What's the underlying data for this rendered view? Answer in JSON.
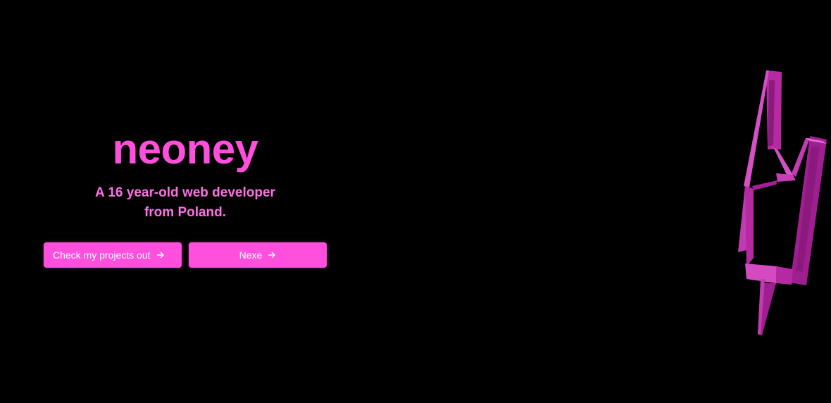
{
  "hero": {
    "title": "neoney",
    "subtitle": "A 16 year-old web developer from Poland."
  },
  "buttons": {
    "projects_label": "Check my projects out",
    "next_label": "Nexe"
  },
  "icons": {
    "button_arrow": "arrow-right-icon",
    "decoration": "lightning-bolt-3d-icon"
  },
  "colors": {
    "background": "#000000",
    "accent": "#ff4fdc",
    "subtitle": "#ff70e6",
    "button_text": "#ffffff"
  }
}
